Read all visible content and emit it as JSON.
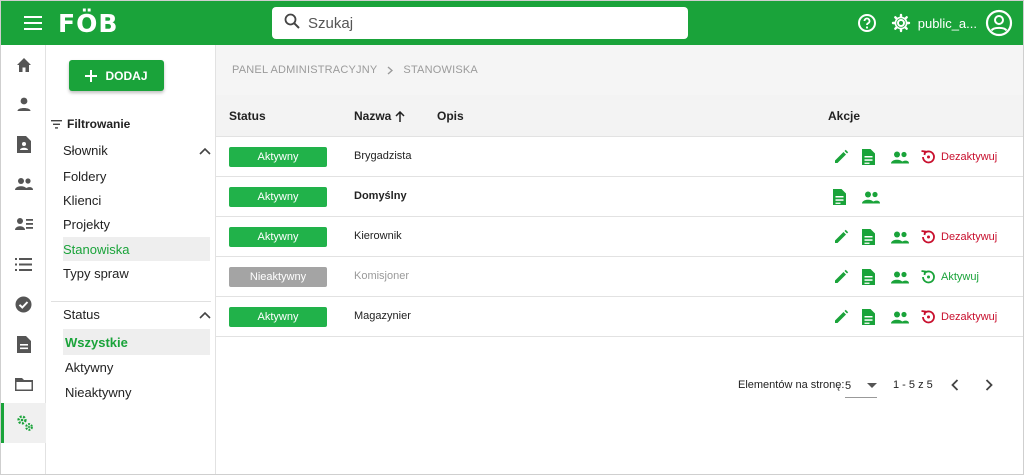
{
  "app": {
    "logo_text": "FÖB"
  },
  "search": {
    "placeholder": "Szukaj"
  },
  "user": {
    "name": "public_a..."
  },
  "breadcrumb": {
    "root": "PANEL ADMINISTRACYJNY",
    "current": "STANOWISKA"
  },
  "filters": {
    "add_label": "DODAJ",
    "title": "Filtrowanie",
    "dictionary": {
      "label": "Słownik",
      "items": [
        "Foldery",
        "Klienci",
        "Projekty",
        "Stanowiska",
        "Typy spraw"
      ],
      "selected": "Stanowiska"
    },
    "status": {
      "label": "Status",
      "items": [
        "Wszystkie",
        "Aktywny",
        "Nieaktywny"
      ],
      "selected": "Wszystkie"
    }
  },
  "table": {
    "columns": {
      "status": "Status",
      "name": "Nazwa",
      "description": "Opis",
      "actions": "Akcje"
    },
    "rows": [
      {
        "status": "Aktywny",
        "name": "Brygadzista",
        "action_text": "Dezaktywuj"
      },
      {
        "status": "Aktywny",
        "name": "Domyślny",
        "action_text": ""
      },
      {
        "status": "Aktywny",
        "name": "Kierownik",
        "action_text": "Dezaktywuj"
      },
      {
        "status": "Nieaktywny",
        "name": "Komisjoner",
        "action_text": "Aktywuj"
      },
      {
        "status": "Aktywny",
        "name": "Magazynier",
        "action_text": "Dezaktywuj"
      }
    ]
  },
  "pagination": {
    "per_page_label": "Elementów na stronę:",
    "per_page": "5",
    "range": "1 - 5 z 5"
  },
  "colors": {
    "brand": "#1aa33a",
    "active_badge": "#21b24a",
    "inactive_badge": "#a4a4a4",
    "danger": "#c8102e"
  },
  "rail_icons": [
    "home-icon",
    "person-icon",
    "contact-document-icon",
    "people-icon",
    "person-list-icon",
    "list-icon",
    "check-circle-icon",
    "document-icon",
    "folder-icon",
    "settings-gears-icon"
  ]
}
